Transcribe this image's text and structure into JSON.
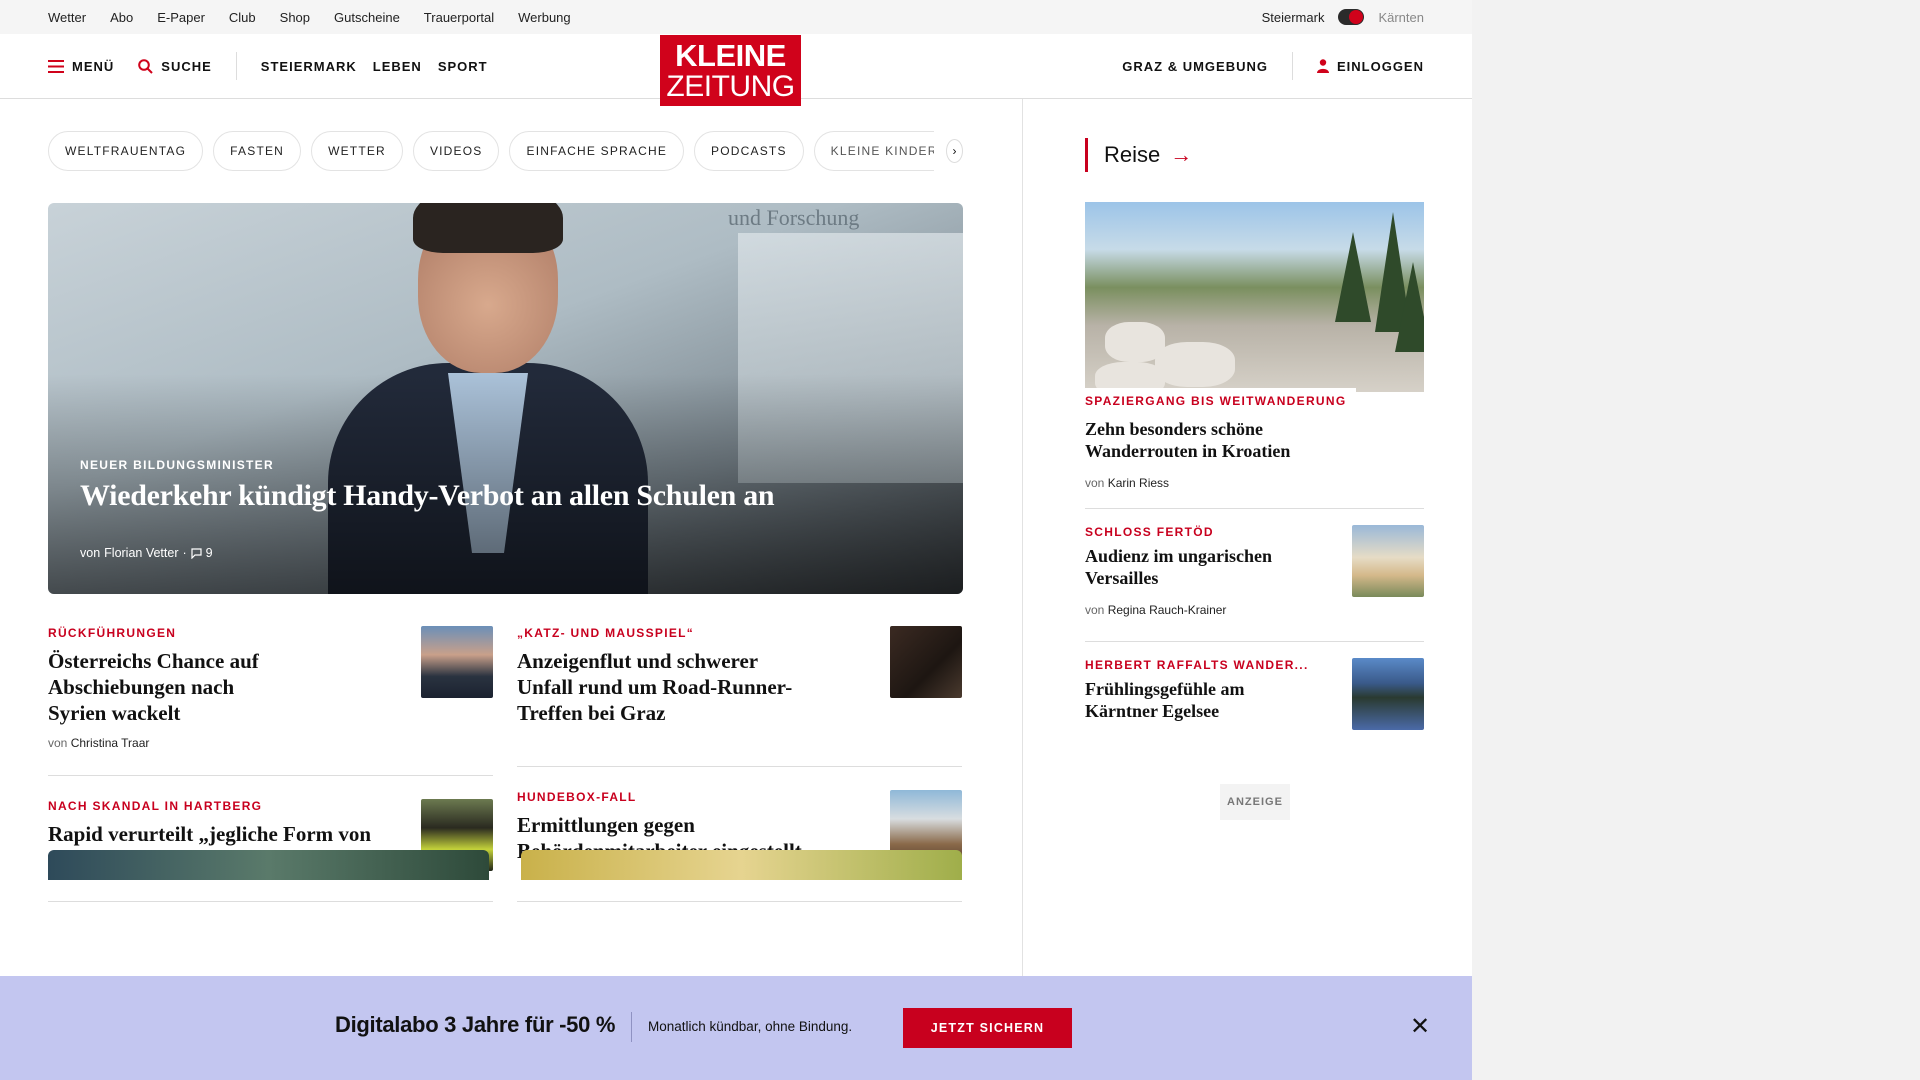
{
  "util_bar": {
    "links": [
      "Wetter",
      "Abo",
      "E-Paper",
      "Club",
      "Shop",
      "Gutscheine",
      "Trauerportal",
      "Werbung"
    ],
    "region_active": "Steiermark",
    "region_inactive": "Kärnten"
  },
  "header": {
    "menu_label": "MENÜ",
    "search_label": "SUCHE",
    "nav": [
      "STEIERMARK",
      "LEBEN",
      "SPORT"
    ],
    "logo_line1": "KLEINE",
    "logo_line2": "ZEITUNG",
    "region_link": "GRAZ & UMGEBUNG",
    "login_label": "EINLOGGEN"
  },
  "chips": [
    "WELTFRAUENTAG",
    "FASTEN",
    "WETTER",
    "VIDEOS",
    "EINFACHE SPRACHE",
    "PODCASTS",
    "KLEINE KINDERZEI"
  ],
  "hero": {
    "background_caption": "und Forschung",
    "kicker": "NEUER BILDUNGSMINISTER",
    "title": "Wiederkehr kündigt Handy-Verbot an allen Schulen an",
    "byline_prefix": "von",
    "author": "Florian Vetter",
    "comments": "9"
  },
  "articles": [
    {
      "kicker": "RÜCKFÜHRUNGEN",
      "title": "Österreichs Chance auf Abschiebungen nach Syrien wackelt",
      "byline_prefix": "von",
      "author": "Christina Traar"
    },
    {
      "kicker": "„KATZ- UND MAUSSPIEL“",
      "title": "Anzeigenflut und schwerer Unfall rund um Road-Runner-Treffen bei Graz"
    },
    {
      "kicker": "NACH SKANDAL IN HARTBERG",
      "title": "Rapid verurteilt „jegliche Form von Gewalt“ und will auf Dialog setzen"
    },
    {
      "kicker": "HUNDEBOX-FALL",
      "title": "Ermittlungen gegen Behördenmitarbeiter eingestellt"
    }
  ],
  "sidebar": {
    "heading": "Reise",
    "main": {
      "kicker": "SPAZIERGANG BIS WEITWANDERUNG",
      "title": "Zehn besonders schöne Wanderrouten in Kroatien",
      "byline_prefix": "von",
      "author": "Karin Riess"
    },
    "items": [
      {
        "kicker": "SCHLOSS FERTÖD",
        "title": "Audienz im ungarischen Versailles",
        "byline_prefix": "von",
        "author": "Regina Rauch-Krainer"
      },
      {
        "kicker": "HERBERT RAFFALTS WANDER...",
        "title": "Frühlingsgefühle am Kärntner Egelsee"
      }
    ],
    "ad_label": "ANZEIGE"
  },
  "promo": {
    "title": "Digitalabo 3 Jahre für -50 %",
    "subtitle": "Monatlich kündbar, ohne Bindung.",
    "button": "JETZT SICHERN",
    "close_icon": "close-icon"
  },
  "colors": {
    "brand_red": "#d0021b",
    "kicker_red": "#c8001e",
    "promo_bg": "#c3c6f0"
  }
}
